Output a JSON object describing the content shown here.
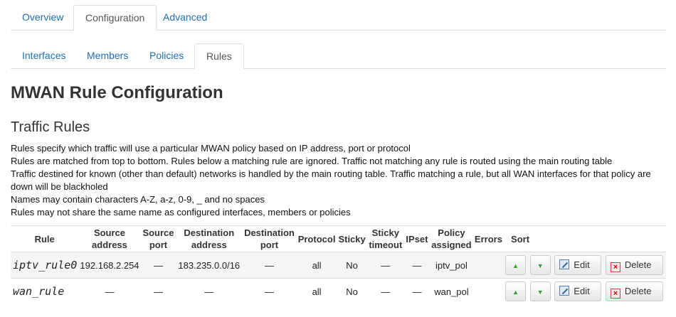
{
  "top_tabs": [
    {
      "label": "Overview",
      "active": false
    },
    {
      "label": "Configuration",
      "active": true
    },
    {
      "label": "Advanced",
      "active": false
    }
  ],
  "sub_tabs": [
    {
      "label": "Interfaces",
      "active": false
    },
    {
      "label": "Members",
      "active": false
    },
    {
      "label": "Policies",
      "active": false
    },
    {
      "label": "Rules",
      "active": true
    }
  ],
  "page_title": "MWAN Rule Configuration",
  "section_title": "Traffic Rules",
  "description": [
    "Rules specify which traffic will use a particular MWAN policy based on IP address, port or protocol",
    "Rules are matched from top to bottom. Rules below a matching rule are ignored. Traffic not matching any rule is routed using the main routing table",
    "Traffic destined for known (other than default) networks is handled by the main routing table. Traffic matching a rule, but all WAN interfaces for that policy are down will be blackholed",
    "Names may contain characters A-Z, a-z, 0-9, _ and no spaces",
    "Rules may not share the same name as configured interfaces, members or policies"
  ],
  "table": {
    "headers": {
      "rule": "Rule",
      "source_address": "Source address",
      "source_port": "Source port",
      "destination_address": "Destination address",
      "destination_port": "Destination port",
      "protocol": "Protocol",
      "sticky": "Sticky",
      "sticky_timeout": "Sticky timeout",
      "ipset": "IPset",
      "policy_assigned": "Policy assigned",
      "errors": "Errors",
      "sort": "Sort"
    },
    "rows": [
      {
        "rule": "iptv_rule0",
        "source_address": "192.168.2.254",
        "source_port": "—",
        "destination_address": "183.235.0.0/16",
        "destination_port": "—",
        "protocol": "all",
        "sticky": "No",
        "sticky_timeout": "—",
        "ipset": "—",
        "policy_assigned": "iptv_pol",
        "errors": ""
      },
      {
        "rule": "wan_rule",
        "source_address": "—",
        "source_port": "—",
        "destination_address": "—",
        "destination_port": "—",
        "protocol": "all",
        "sticky": "No",
        "sticky_timeout": "—",
        "ipset": "—",
        "policy_assigned": "wan_pol",
        "errors": ""
      }
    ]
  },
  "buttons": {
    "move_up_glyph": "▲",
    "move_down_glyph": "▼",
    "edit_label": "Edit",
    "delete_label": "Delete",
    "delete_glyph": "×"
  },
  "icons": {
    "edit": "edit-icon",
    "delete": "delete-icon",
    "up": "arrow-up-icon",
    "down": "arrow-down-icon"
  },
  "colors": {
    "link": "#1f6fb5",
    "row_alt": "#f5f5f5",
    "arrow": "#2e9e2e",
    "border": "#dddddd"
  }
}
